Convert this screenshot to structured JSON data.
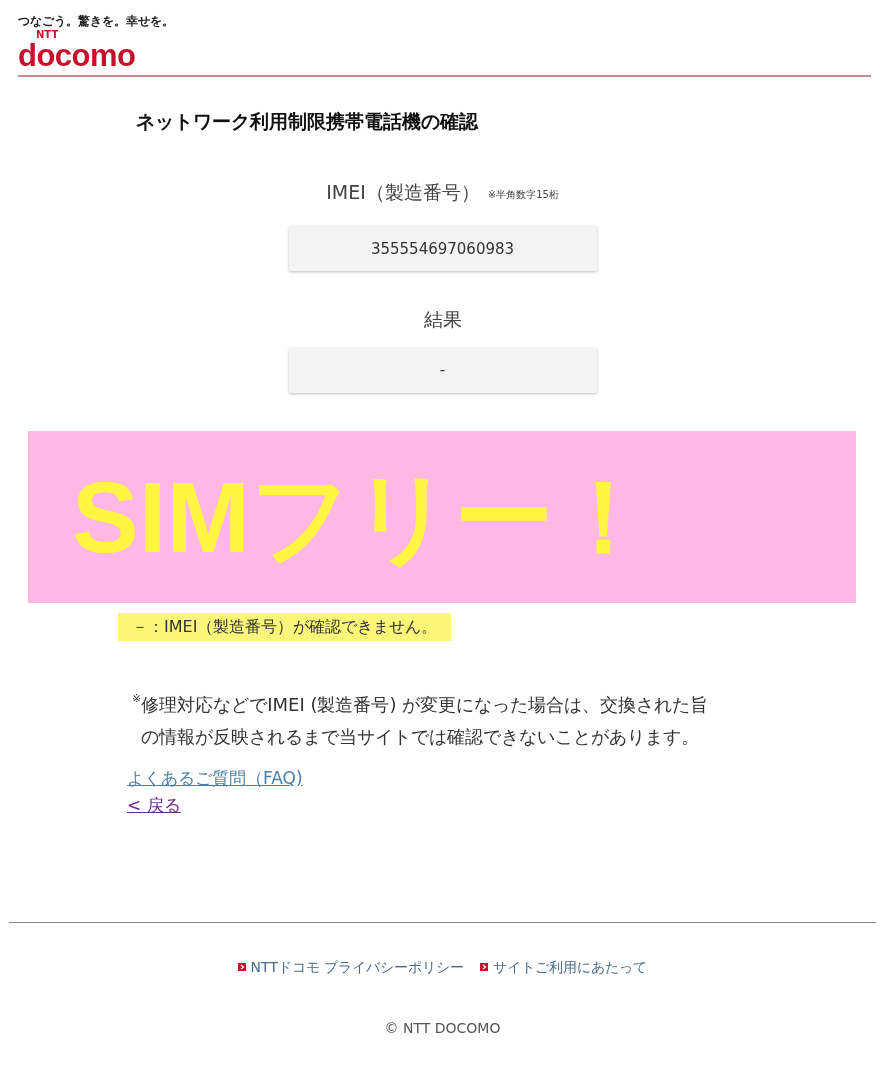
{
  "header": {
    "tagline": "つなごう。驚きを。幸せを。",
    "logo_small": "NTT",
    "logo": "docomo"
  },
  "title": "ネットワーク利用制限携帯電話機の確認",
  "imei": {
    "label": "IMEI（製造番号）",
    "hint": "※半角数字15桁",
    "value": "355554697060983"
  },
  "result": {
    "label": "結果",
    "value": "-"
  },
  "overlay": {
    "text": "SIMフリー！"
  },
  "legend": {
    "text": "－：IMEI（製造番号）が確認できません。",
    "highlighted": true
  },
  "note": {
    "mark": "※",
    "text": "修理対応などでIMEI (製造番号) が変更になった場合は、交換された旨の情報が反映されるまで当サイトでは確認できないことがあります。"
  },
  "links": [
    {
      "text": "よくあるご質問（FAQ)",
      "visited": false
    },
    {
      "text": "< 戻る",
      "visited": true
    }
  ],
  "footer": {
    "links": [
      "NTTドコモ プライバシーポリシー",
      "サイトご利用にあたって"
    ],
    "copyright": "© NTT DOCOMO"
  }
}
